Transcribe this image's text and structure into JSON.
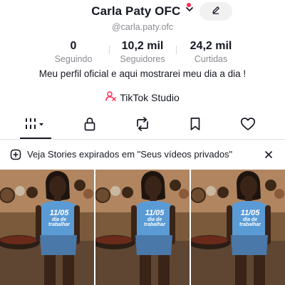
{
  "profile": {
    "display_name": "Carla Paty OFC",
    "username": "@carla.paty.ofc",
    "bio": "Meu perfil oficial e aqui mostrarei meu dia a dia !",
    "studio_label": "TikTok Studio"
  },
  "stats": [
    {
      "value": "0",
      "label": "Seguindo"
    },
    {
      "value": "10,2 mil",
      "label": "Seguidores"
    },
    {
      "value": "24,2 mil",
      "label": "Curtidas"
    }
  ],
  "tabs": [
    {
      "icon": "grid-icon",
      "selected": true
    },
    {
      "icon": "lock-icon"
    },
    {
      "icon": "repost-icon"
    },
    {
      "icon": "bookmark-icon"
    },
    {
      "icon": "heart-icon"
    }
  ],
  "banner": {
    "text": "Veja Stories expirados em \"Seus vídeos privados\"",
    "icon": "add-circle-icon",
    "close_icon": "close-icon"
  },
  "videos": [
    {
      "shirt_line1": "11/05",
      "shirt_line2": "dia de",
      "shirt_line3": "trabalhar"
    },
    {
      "shirt_line1": "11/05",
      "shirt_line2": "dia de",
      "shirt_line3": "trabalhar"
    },
    {
      "shirt_line1": "11/05",
      "shirt_line2": "dia de",
      "shirt_line3": "trabalhar"
    }
  ],
  "colors": {
    "accent": "#fe2c55",
    "text": "#161823",
    "muted": "#8a8b91",
    "shirt": "#5b9bd5"
  }
}
